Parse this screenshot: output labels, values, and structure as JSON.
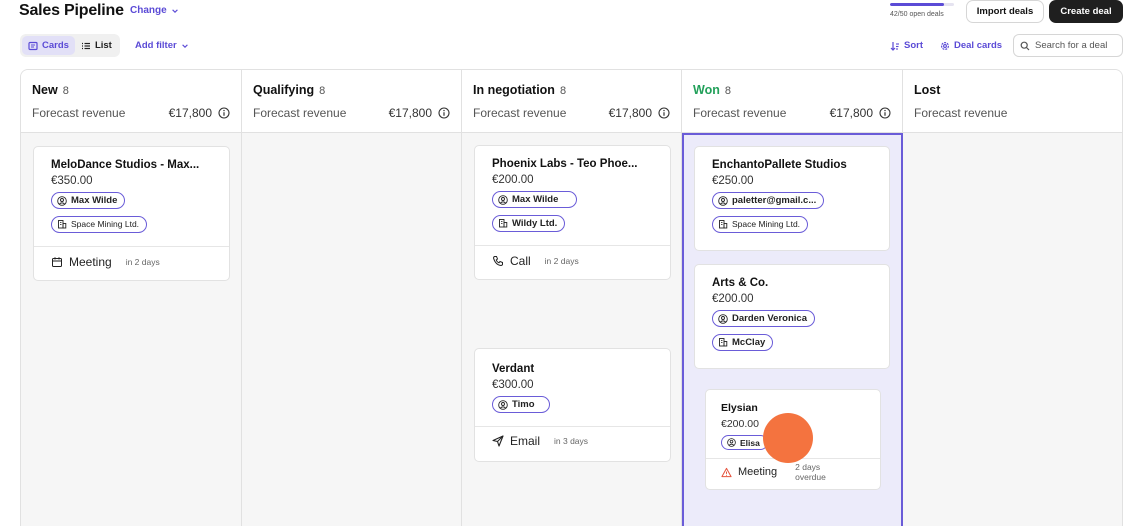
{
  "header": {
    "title": "Sales Pipeline",
    "change_label": "Change",
    "open_deals_text": "42/50 open deals",
    "open_deals_fraction": 0.84,
    "import_label": "Import deals",
    "create_label": "Create deal"
  },
  "toolbar": {
    "view_cards": "Cards",
    "view_list": "List",
    "add_filter": "Add filter",
    "sort": "Sort",
    "deal_cards": "Deal cards",
    "search_placeholder": "Search for a deal"
  },
  "columns": [
    {
      "name": "New",
      "count": "8",
      "forecast_label": "Forecast revenue",
      "forecast_amount": "€17,800"
    },
    {
      "name": "Qualifying",
      "count": "8",
      "forecast_label": "Forecast revenue",
      "forecast_amount": "€17,800"
    },
    {
      "name": "In negotiation",
      "count": "8",
      "forecast_label": "Forecast revenue",
      "forecast_amount": "€17,800"
    },
    {
      "name": "Won",
      "count": "8",
      "forecast_label": "Forecast revenue",
      "forecast_amount": "€17,800"
    },
    {
      "name": "Lost",
      "count": "",
      "forecast_label": "Forecast revenue",
      "forecast_amount": ""
    }
  ],
  "cards": {
    "melodance": {
      "name": "MeloDance Studios - Max...",
      "amount": "€350.00",
      "contact": "Max Wilde",
      "org": "Space Mining Ltd.",
      "activity": "Meeting",
      "due": "in 2 days"
    },
    "phoenix": {
      "name": "Phoenix Labs - Teo Phoe...",
      "amount": "€200.00",
      "contact": "Max Wilde",
      "org": "Wildy Ltd.",
      "activity": "Call",
      "due": "in 2 days"
    },
    "verdant": {
      "name": "Verdant",
      "amount": "€300.00",
      "contact": "Timo",
      "activity": "Email",
      "due": "in 3 days"
    },
    "enchanto": {
      "name": "EnchantoPallete Studios",
      "amount": "€250.00",
      "contact": "paletter@gmail.c...",
      "org": "Space Mining Ltd."
    },
    "arts": {
      "name": "Arts & Co.",
      "amount": "€200.00",
      "contact": "Darden Veronica",
      "org": "McClay"
    },
    "elysian": {
      "name": "Elysian",
      "amount": "€200.00",
      "contact": "Elisa",
      "activity": "Meeting",
      "due_line1": "2 days",
      "due_line2": "overdue"
    }
  },
  "colors": {
    "accent": "#5b4bd6",
    "won_green": "#22a05a",
    "warning": "#e5533d",
    "cursor": "#f4733f"
  }
}
